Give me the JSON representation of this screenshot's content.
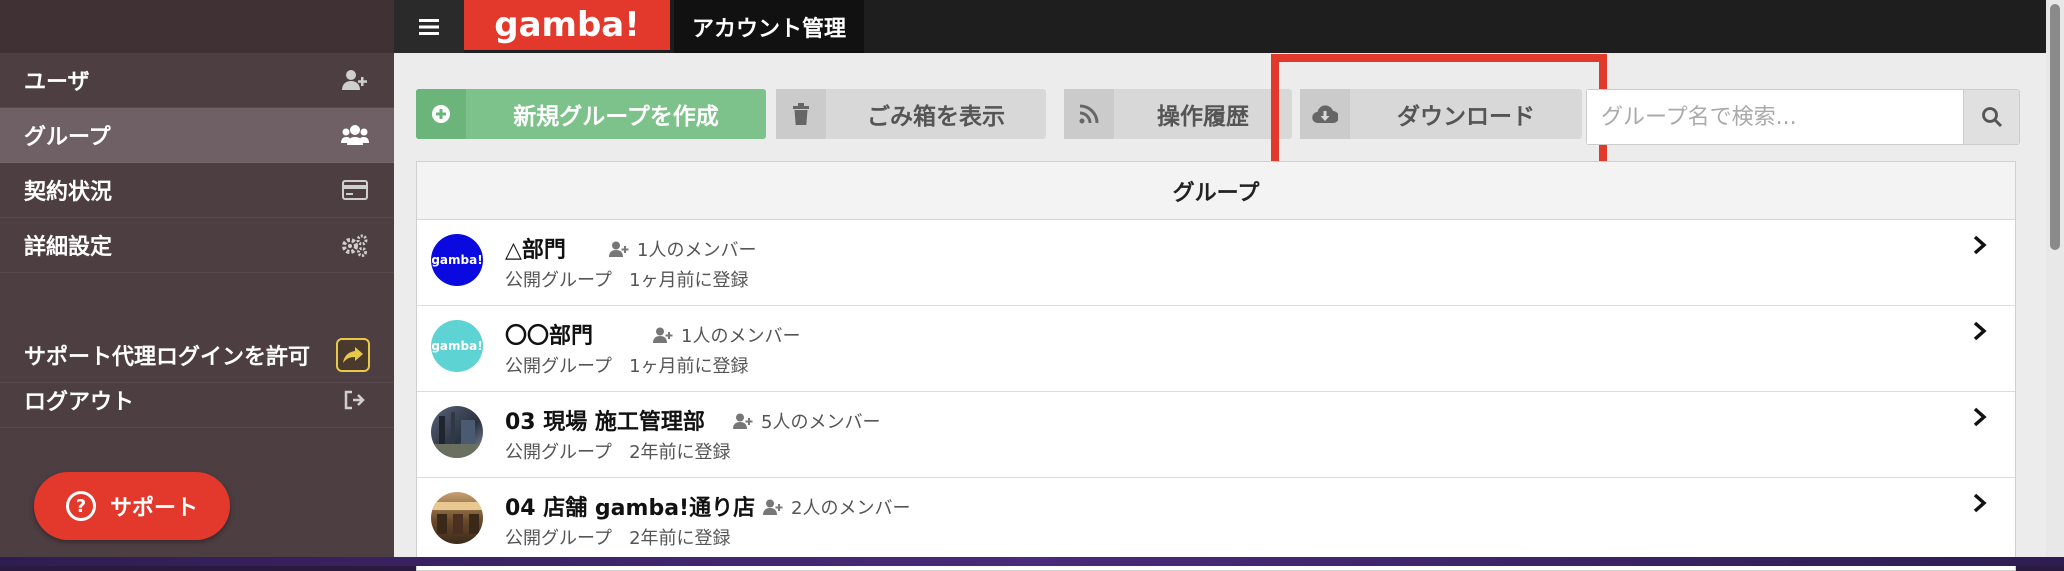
{
  "header": {
    "logo_text": "gamba!",
    "section_title": "アカウント管理"
  },
  "sidebar": {
    "items": [
      {
        "label": "ユーザ",
        "icon": "user-plus-icon"
      },
      {
        "label": "グループ",
        "icon": "users-icon"
      },
      {
        "label": "契約状況",
        "icon": "credit-card-icon"
      },
      {
        "label": "詳細設定",
        "icon": "gears-icon"
      },
      {
        "label": "サポート代理ログインを許可",
        "icon": "share-icon"
      },
      {
        "label": "ログアウト",
        "icon": "sign-out-icon"
      }
    ],
    "support_button": "サポート"
  },
  "toolbar": {
    "new_group": "新規グループを作成",
    "trash": "ごみ箱を表示",
    "history": "操作履歴",
    "download": "ダウンロード",
    "search_placeholder": "グループ名で検索..."
  },
  "panel": {
    "title": "グループ",
    "groups": [
      {
        "name": "△部門",
        "members": "1人のメンバー",
        "visibility": "公開グループ",
        "registered": "1ヶ月前に登録",
        "avatar_text": "gamba!",
        "avatar_color": "#0a0ae0"
      },
      {
        "name": "〇〇部門",
        "members": "1人のメンバー",
        "visibility": "公開グループ",
        "registered": "1ヶ月前に登録",
        "avatar_text": "gamba!",
        "avatar_color": "#5ed3d3"
      },
      {
        "name": "03 現場 施工管理部",
        "members": "5人のメンバー",
        "visibility": "公開グループ",
        "registered": "2年前に登録",
        "avatar_text": "",
        "avatar_color": "#3a4658"
      },
      {
        "name": "04 店舗 gamba!通り店",
        "members": "2人のメンバー",
        "visibility": "公開グループ",
        "registered": "2年前に登録",
        "avatar_text": "",
        "avatar_color": "#7a5a3a"
      }
    ]
  },
  "colors": {
    "brand_red": "#e3392c",
    "new_button_green": "#7dc28a",
    "sidebar_bg": "#4d3e42",
    "highlight": "#e1392b"
  }
}
